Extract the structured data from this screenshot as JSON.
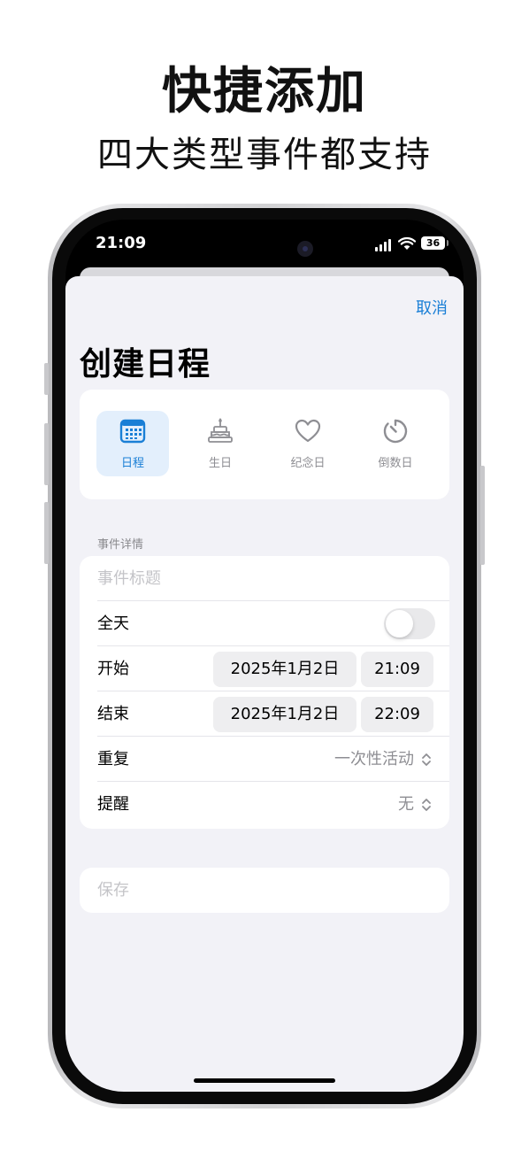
{
  "promo": {
    "headline": "快捷添加",
    "subline": "四大类型事件都支持"
  },
  "statusbar": {
    "time": "21:09",
    "battery": "36"
  },
  "sheet": {
    "cancel_label": "取消",
    "title": "创建日程"
  },
  "types": [
    {
      "label": "日程",
      "icon": "calendar-icon",
      "selected": true
    },
    {
      "label": "生日",
      "icon": "cake-icon",
      "selected": false
    },
    {
      "label": "纪念日",
      "icon": "heart-icon",
      "selected": false
    },
    {
      "label": "倒数日",
      "icon": "timer-icon",
      "selected": false
    }
  ],
  "form": {
    "section_label": "事件详情",
    "title_placeholder": "事件标题",
    "all_day_label": "全天",
    "all_day_on": false,
    "start_label": "开始",
    "start_date": "2025年1月2日",
    "start_time": "21:09",
    "end_label": "结束",
    "end_date": "2025年1月2日",
    "end_time": "22:09",
    "repeat_label": "重复",
    "repeat_value": "一次性活动",
    "reminder_label": "提醒",
    "reminder_value": "无"
  },
  "save_label": "保存",
  "colors": {
    "accent": "#1a7fd6",
    "selected_bg": "#e3effc",
    "sheet_bg": "#f2f2f7",
    "muted": "#8e8e93"
  }
}
